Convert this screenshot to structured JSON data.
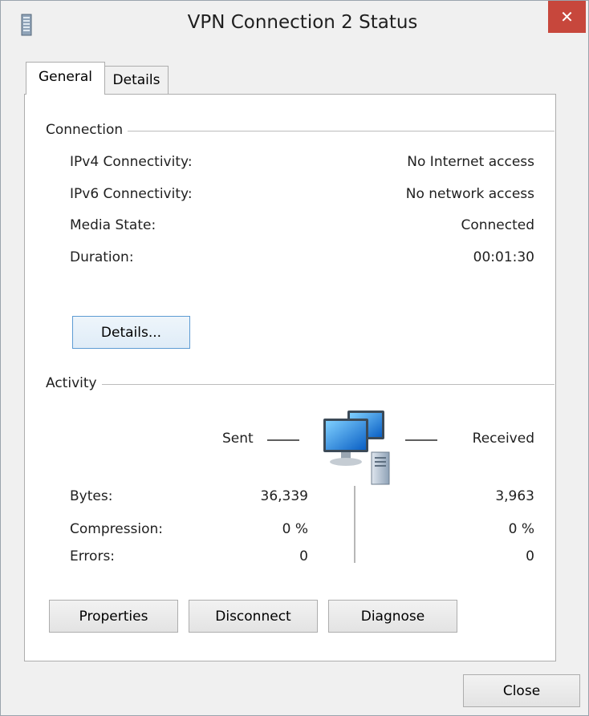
{
  "window": {
    "title": "VPN Connection 2 Status",
    "close_glyph": "✕",
    "app_icon": "network-adapter-icon"
  },
  "tabs": [
    {
      "label": "General",
      "active": true
    },
    {
      "label": "Details",
      "active": false
    }
  ],
  "connection": {
    "group_title": "Connection",
    "rows": [
      {
        "label": "IPv4 Connectivity:",
        "value": "No Internet access"
      },
      {
        "label": "IPv6 Connectivity:",
        "value": "No network access"
      },
      {
        "label": "Media State:",
        "value": "Connected"
      },
      {
        "label": "Duration:",
        "value": "00:01:30"
      }
    ],
    "details_button": "Details..."
  },
  "activity": {
    "group_title": "Activity",
    "sent_label": "Sent",
    "received_label": "Received",
    "icon": "network-computers-icon",
    "rows": [
      {
        "label": "Bytes:",
        "sent": "36,339",
        "received": "3,963"
      },
      {
        "label": "Compression:",
        "sent": "0 %",
        "received": "0 %"
      },
      {
        "label": "Errors:",
        "sent": "0",
        "received": "0"
      }
    ]
  },
  "buttons": {
    "properties": "Properties",
    "disconnect": "Disconnect",
    "diagnose": "Diagnose",
    "close": "Close"
  },
  "colors": {
    "close_button": "#c7473c",
    "focus_border": "#5d9bd3",
    "window_bg": "#f0f0f0"
  }
}
